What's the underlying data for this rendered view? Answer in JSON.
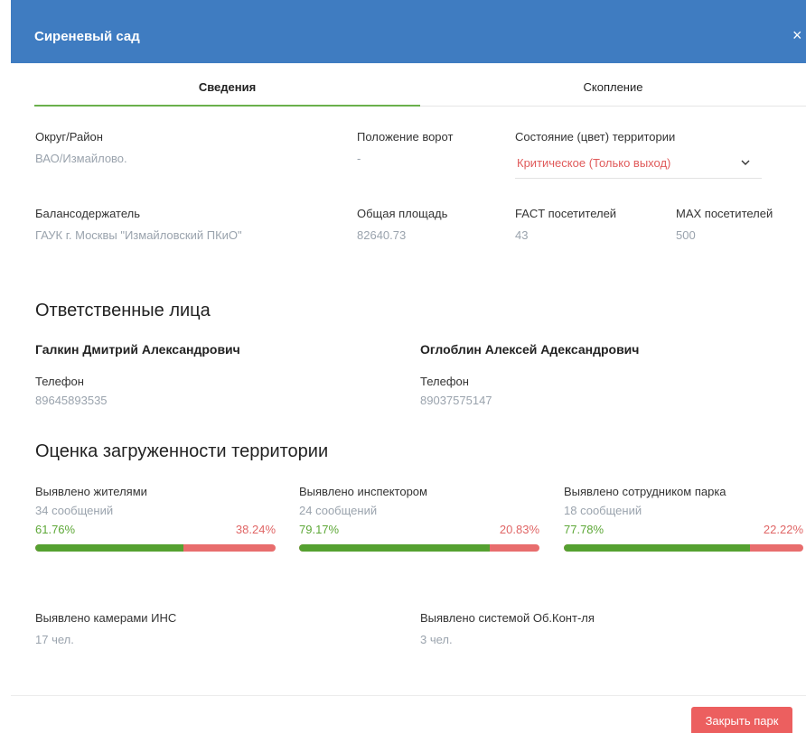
{
  "header": {
    "title": "Сиреневый сад",
    "close_icon": "×"
  },
  "tabs": [
    {
      "label": "Сведения",
      "active": true
    },
    {
      "label": "Скопление",
      "active": false
    }
  ],
  "info": {
    "district_label": "Округ/Район",
    "district_value": "ВАО/Измайлово.",
    "gate_label": "Положение ворот",
    "gate_value": "-",
    "state_label": "Состояние (цвет) территории",
    "state_value": "Критическое (Только выход)",
    "holder_label": "Балансодержатель",
    "holder_value": "ГАУК г. Москвы \"Измайловский ПКиО\"",
    "area_label": "Общая площадь",
    "area_value": "82640.73",
    "fact_label": "FACT посетителей",
    "fact_value": "43",
    "max_label": "MAX посетителей",
    "max_value": "500"
  },
  "responsible": {
    "title": "Ответственные лица",
    "persons": [
      {
        "name": "Галкин Дмитрий Александрович",
        "phone_label": "Телефон",
        "phone": "89645893535"
      },
      {
        "name": "Оглоблин Алексей Адександрович",
        "phone_label": "Телефон",
        "phone": "89037575147"
      }
    ]
  },
  "load": {
    "title": "Оценка загруженности территории",
    "blocks": [
      {
        "label": "Выявлено жителями",
        "count": "34 сообщений",
        "green_pct": "61.76%",
        "red_pct": "38.24%",
        "fill": 0.6176
      },
      {
        "label": "Выявлено инспектором",
        "count": "24 сообщений",
        "green_pct": "79.17%",
        "red_pct": "20.83%",
        "fill": 0.7917
      },
      {
        "label": "Выявлено сотрудником парка",
        "count": "18 сообщений",
        "green_pct": "77.78%",
        "red_pct": "22.22%",
        "fill": 0.7778
      }
    ],
    "cameras_label": "Выявлено камерами ИНС",
    "cameras_value": "17 чел.",
    "system_label": "Выявлено системой Об.Конт-ля",
    "system_value": "3 чел."
  },
  "footer": {
    "close_park_label": "Закрыть парк"
  },
  "colors": {
    "header": "#3f7cc1",
    "accent_green": "#55a131",
    "accent_red": "#e86d6d",
    "button_red": "#ec5f5f"
  }
}
